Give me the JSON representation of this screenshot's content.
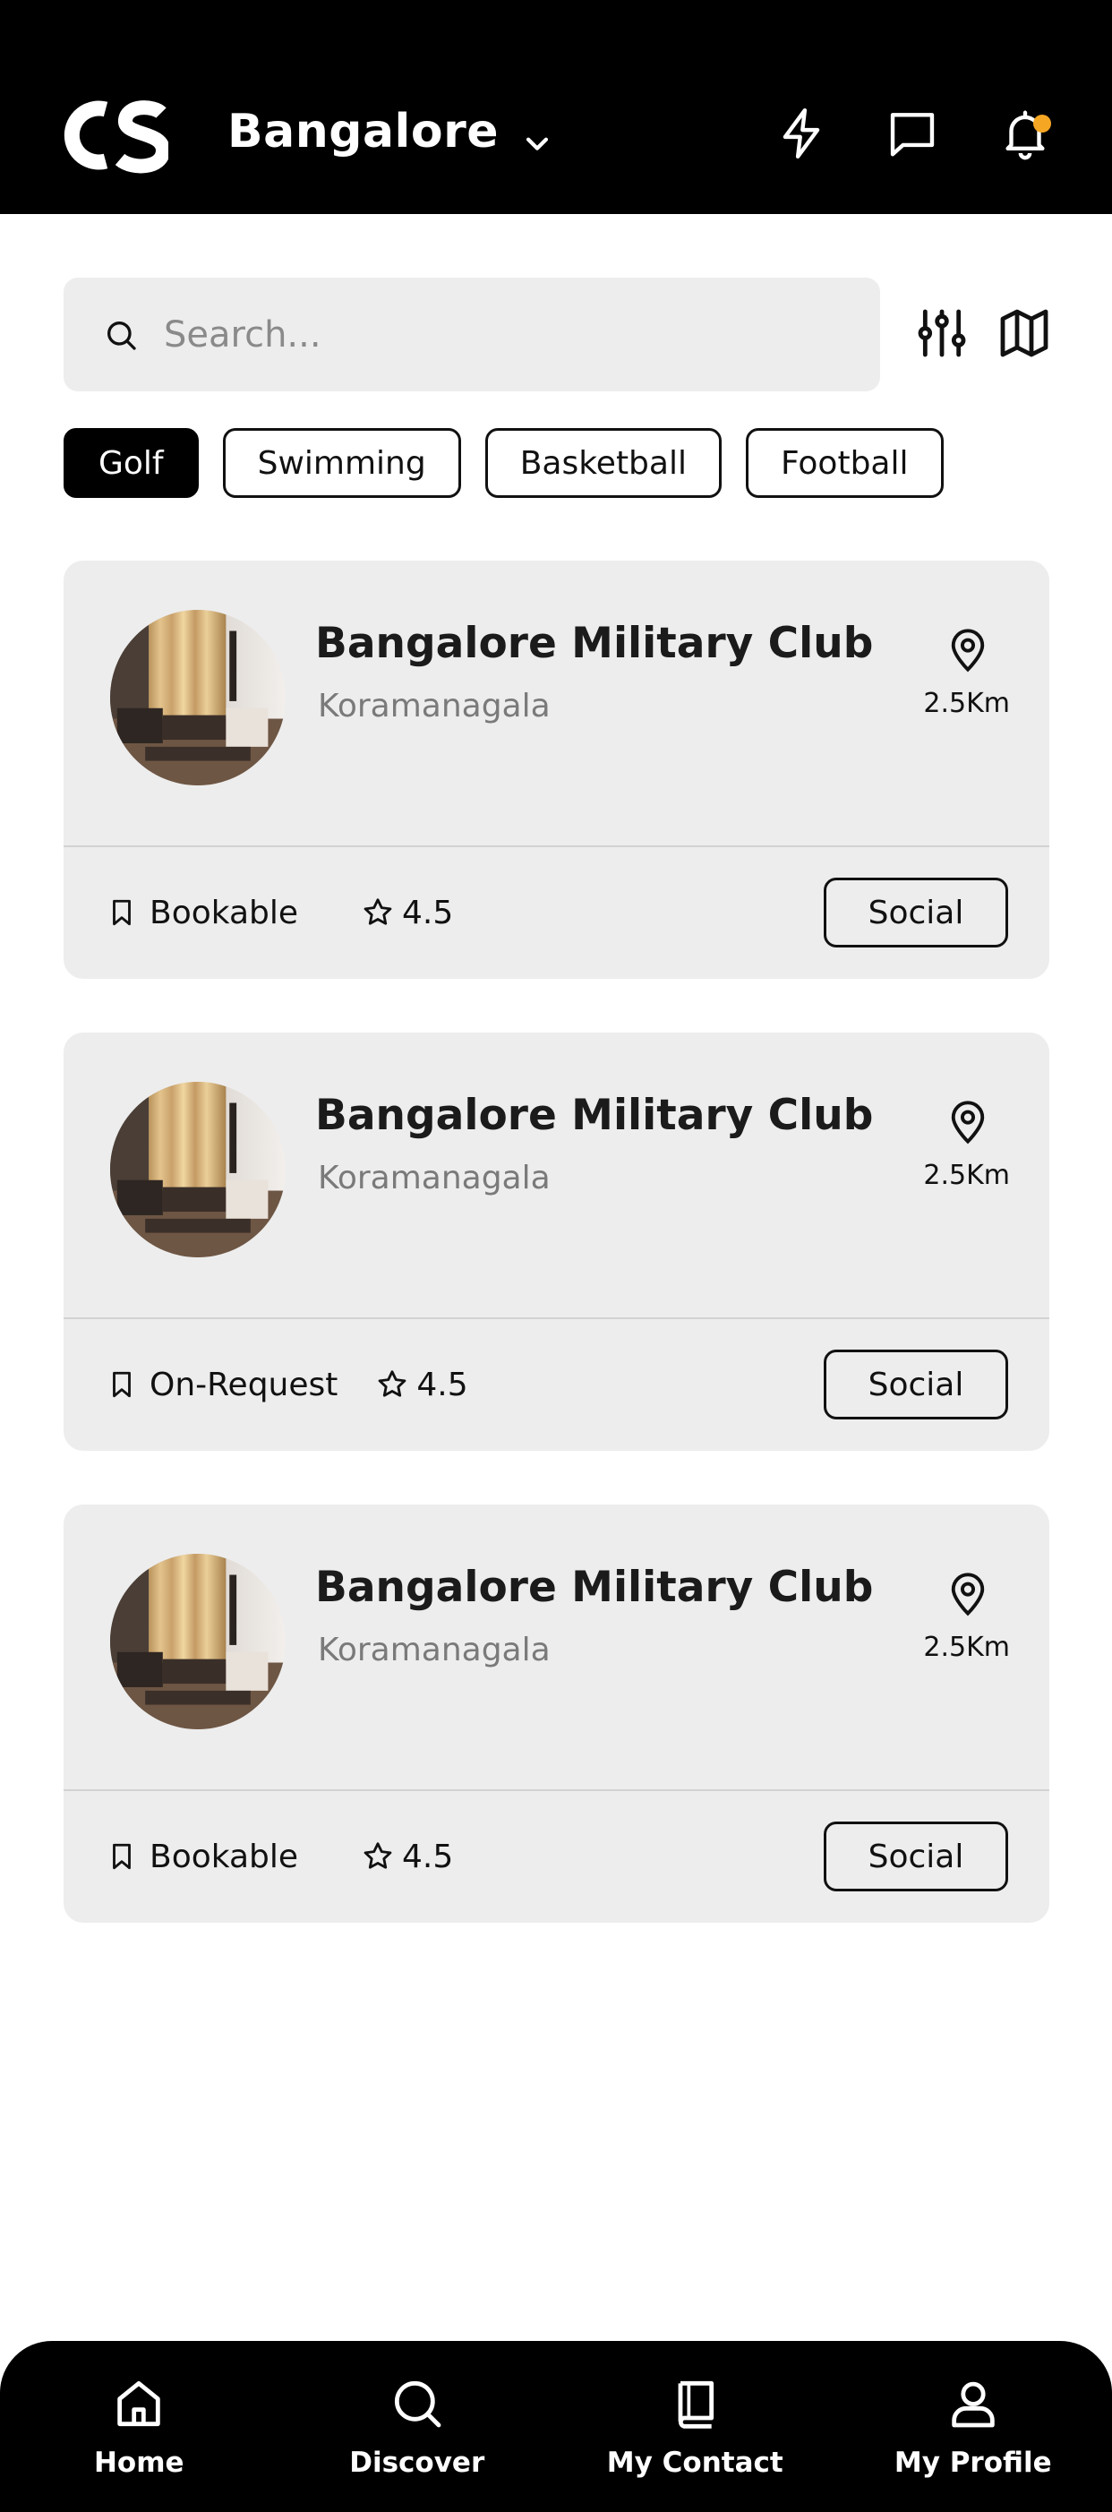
{
  "header": {
    "logo_text": "CS",
    "city": "Bangalore",
    "icons": [
      "flash-icon",
      "chat-icon",
      "bell-icon"
    ],
    "notification_dot_color": "#F5A623"
  },
  "search": {
    "placeholder": "Search..."
  },
  "filters": [
    {
      "label": "Golf",
      "active": true
    },
    {
      "label": "Swimming",
      "active": false
    },
    {
      "label": "Basketball",
      "active": false
    },
    {
      "label": "Football",
      "active": false
    }
  ],
  "clubs": [
    {
      "name": "Bangalore Military Club",
      "area": "Koramanagala",
      "distance": "2.5Km",
      "booking": "Bookable",
      "rating": "4.5",
      "tag": "Social"
    },
    {
      "name": "Bangalore Military Club",
      "area": "Koramanagala",
      "distance": "2.5Km",
      "booking": "On-Request",
      "rating": "4.5",
      "tag": "Social"
    },
    {
      "name": "Bangalore Military Club",
      "area": "Koramanagala",
      "distance": "2.5Km",
      "booking": "Bookable",
      "rating": "4.5",
      "tag": "Social"
    }
  ],
  "nav": [
    {
      "label": "Home",
      "icon": "home-icon"
    },
    {
      "label": "Discover",
      "icon": "search-icon"
    },
    {
      "label": "My Contact",
      "icon": "book-icon"
    },
    {
      "label": "My Profile",
      "icon": "user-icon"
    }
  ]
}
